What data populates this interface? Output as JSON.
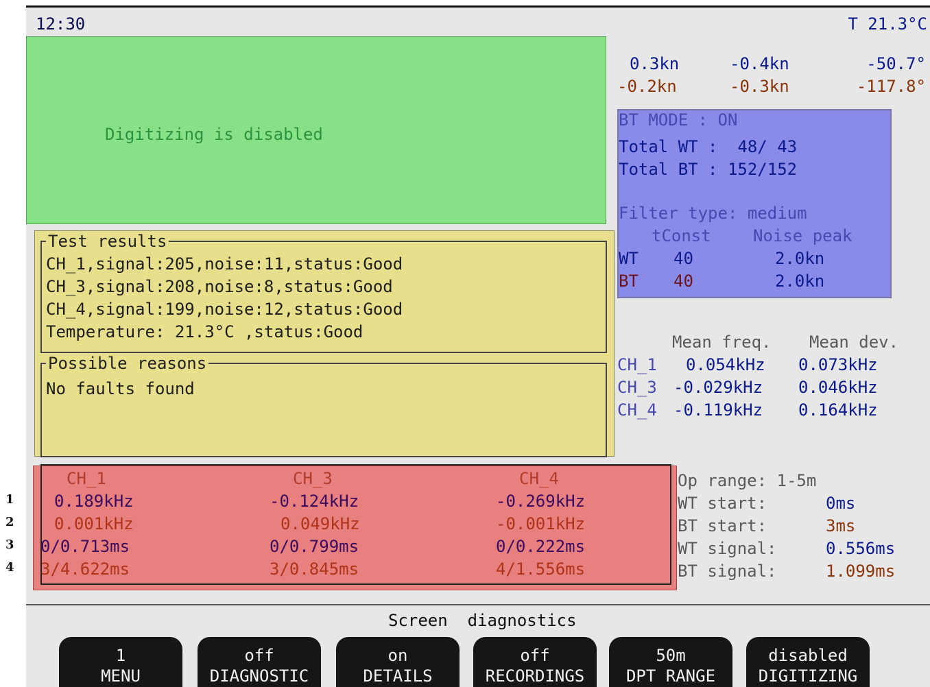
{
  "status_bar": {
    "time": "12:30",
    "temperature": "T 21.3°C"
  },
  "digitizing": {
    "message": "Digitizing is disabled"
  },
  "speed": {
    "row1": [
      "0.3kn",
      "-0.4kn",
      "-50.7°"
    ],
    "row2": [
      "-0.2kn",
      "-0.3kn",
      "-117.8°"
    ]
  },
  "bt_panel": {
    "mode": "BT MODE : ON",
    "total_wt": "Total WT :  48/ 43",
    "total_bt": "Total BT : 152/152",
    "filter_type": "Filter type: medium",
    "header_tconst": "tConst",
    "header_noise": "Noise peak",
    "rows": [
      {
        "label": "WT",
        "tconst": "40",
        "noise": "2.0kn"
      },
      {
        "label": "BT",
        "tconst": "40",
        "noise": "2.0kn"
      }
    ]
  },
  "test_results": {
    "title": "Test results",
    "lines": [
      "CH_1,signal:205,noise:11,status:Good",
      "CH_3,signal:208,noise:8,status:Good",
      "CH_4,signal:199,noise:12,status:Good",
      "Temperature: 21.3°C ,status:Good"
    ]
  },
  "possible_reasons": {
    "title": "Possible reasons",
    "text": "No faults found"
  },
  "frequency": {
    "header_mean_freq": "Mean freq.",
    "header_mean_dev": "Mean dev.",
    "rows": [
      {
        "ch": "CH_1",
        "freq": "0.054kHz",
        "dev": "0.073kHz"
      },
      {
        "ch": "CH_3",
        "freq": "-0.029kHz",
        "dev": "0.046kHz"
      },
      {
        "ch": "CH_4",
        "freq": "-0.119kHz",
        "dev": "0.164kHz"
      }
    ]
  },
  "channel_table": {
    "headers": [
      "CH_1",
      "CH_3",
      "CH_4"
    ],
    "row_labels": [
      "1",
      "2",
      "3",
      "4"
    ],
    "rows": [
      [
        "0.189kHz",
        "-0.124kHz",
        "-0.269kHz"
      ],
      [
        "0.001kHz",
        "0.049kHz",
        "-0.001kHz"
      ],
      [
        "0/0.713ms",
        "0/0.799ms",
        "0/0.222ms"
      ],
      [
        "3/4.622ms",
        "3/0.845ms",
        "4/1.556ms"
      ]
    ]
  },
  "op_info": {
    "op_range": "Op range: 1-5m",
    "wt_start_label": "WT start:",
    "wt_start_value": "0ms",
    "bt_start_label": "BT start:",
    "bt_start_value": "3ms",
    "wt_signal_label": "WT signal:",
    "wt_signal_value": "0.556ms",
    "bt_signal_label": "BT signal:",
    "bt_signal_value": "1.099ms"
  },
  "screen_title": "Screen  diagnostics",
  "softkeys": [
    {
      "value": "1",
      "label": "MENU"
    },
    {
      "value": "off",
      "label": "DIAGNOSTIC"
    },
    {
      "value": "on",
      "label": "DETAILS"
    },
    {
      "value": "off",
      "label": "RECORDINGS"
    },
    {
      "value": "50m",
      "label": "DPT RANGE"
    },
    {
      "value": "disabled",
      "label": "DIGITIZING"
    }
  ]
}
